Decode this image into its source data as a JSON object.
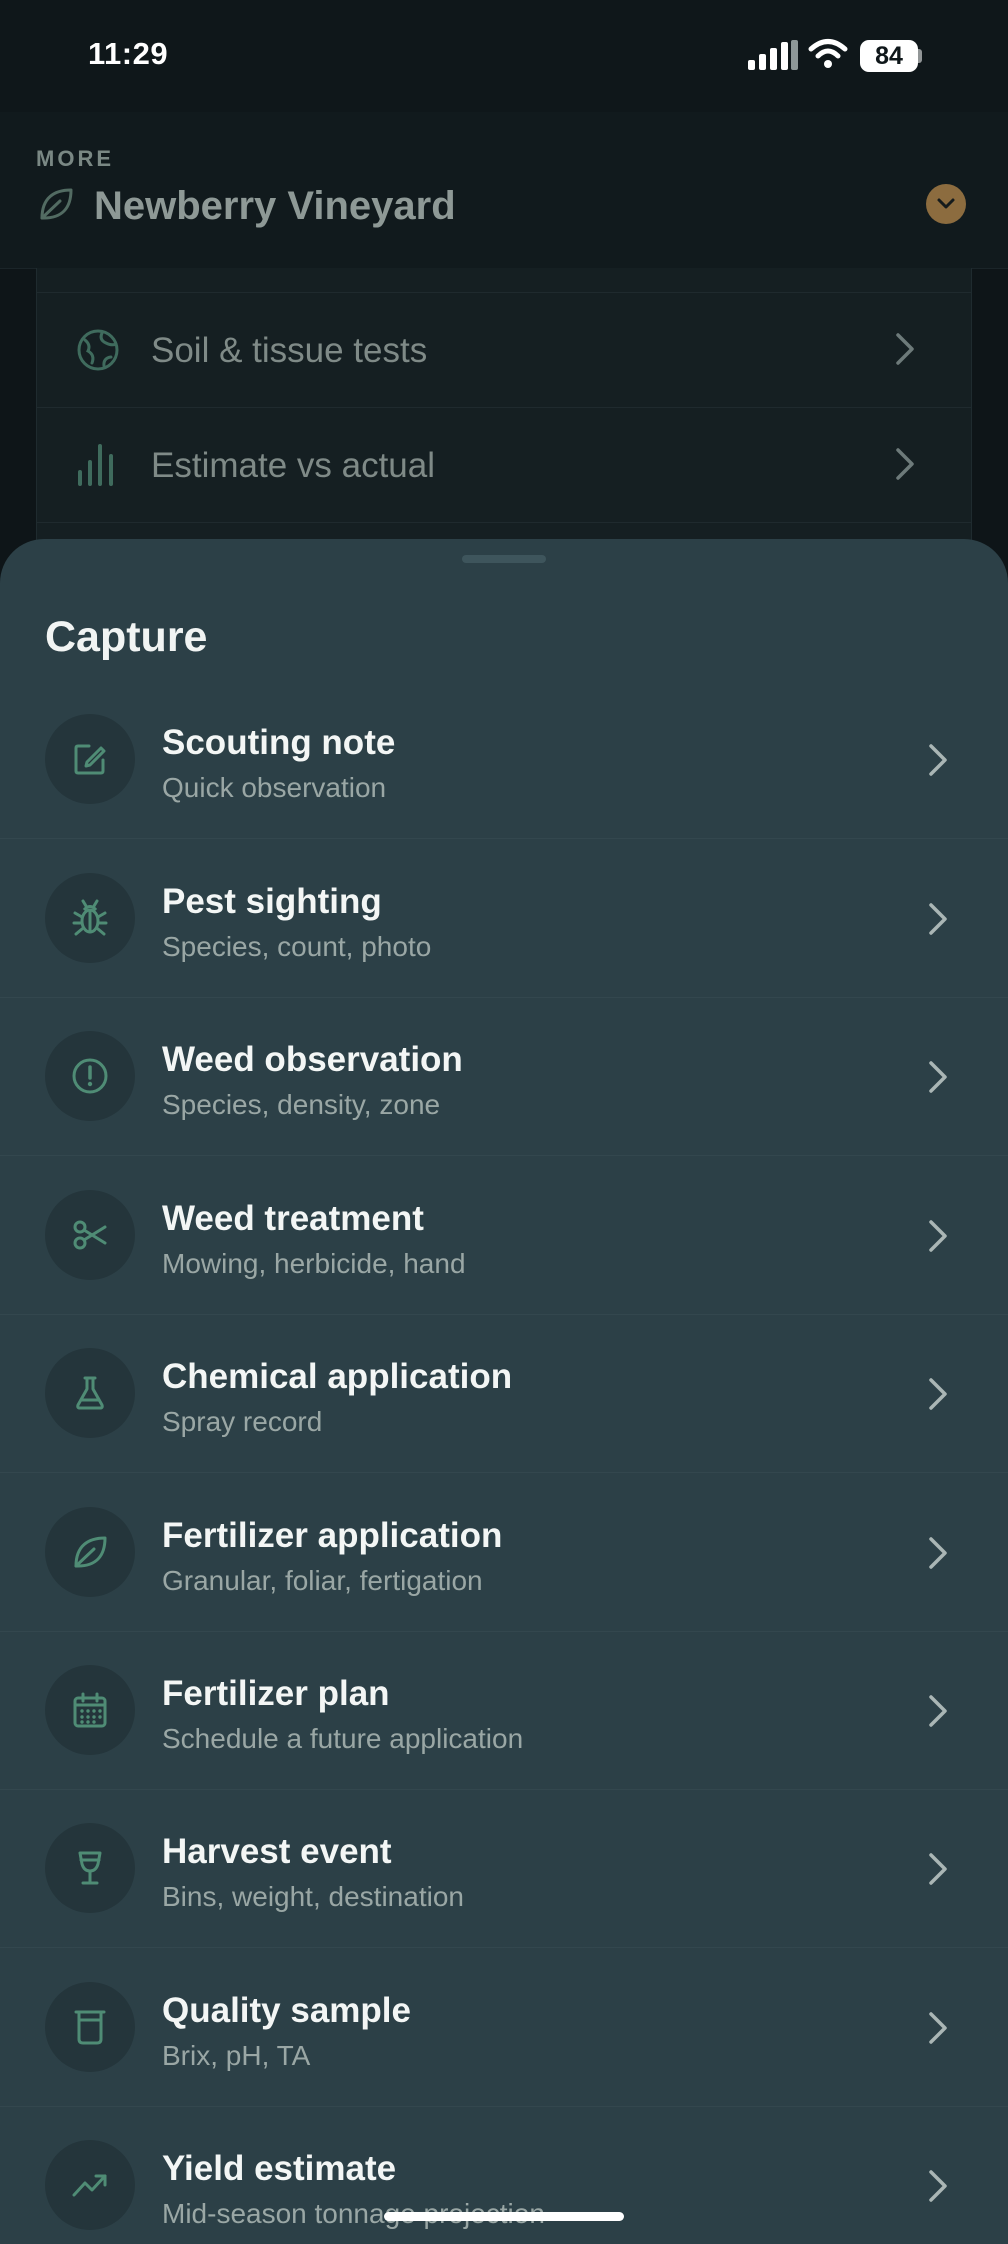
{
  "status_bar": {
    "time": "11:29",
    "battery": "84"
  },
  "header": {
    "eyebrow": "MORE",
    "vineyard_name": "Newberry Vineyard",
    "icon": "leaf-icon",
    "toggle_icon": "chevron-down-icon",
    "accent_color": "#8c6c3f"
  },
  "background_menu": {
    "items": [
      {
        "label": "Soil & tissue tests",
        "icon": "globe-icon"
      },
      {
        "label": "Estimate vs actual",
        "icon": "bar-chart-icon"
      }
    ]
  },
  "sheet": {
    "title": "Capture",
    "items": [
      {
        "title": "Scouting note",
        "subtitle": "Quick observation",
        "icon": "edit-note-icon"
      },
      {
        "title": "Pest sighting",
        "subtitle": "Species, count, photo",
        "icon": "bug-icon"
      },
      {
        "title": "Weed observation",
        "subtitle": "Species, density, zone",
        "icon": "alert-circle-icon"
      },
      {
        "title": "Weed treatment",
        "subtitle": "Mowing, herbicide, hand",
        "icon": "scissors-icon"
      },
      {
        "title": "Chemical application",
        "subtitle": "Spray record",
        "icon": "flask-icon"
      },
      {
        "title": "Fertilizer application",
        "subtitle": "Granular, foliar, fertigation",
        "icon": "leaf-icon"
      },
      {
        "title": "Fertilizer plan",
        "subtitle": "Schedule a future application",
        "icon": "calendar-icon"
      },
      {
        "title": "Harvest event",
        "subtitle": "Bins, weight, destination",
        "icon": "wine-glass-icon"
      },
      {
        "title": "Quality sample",
        "subtitle": "Brix, pH, TA",
        "icon": "beaker-icon"
      },
      {
        "title": "Yield estimate",
        "subtitle": "Mid-season tonnage projection",
        "icon": "trend-up-icon"
      }
    ]
  },
  "colors": {
    "sheet_background": "#2c4047",
    "icon_green": "#4f8c75",
    "app_background": "#0e1518"
  }
}
